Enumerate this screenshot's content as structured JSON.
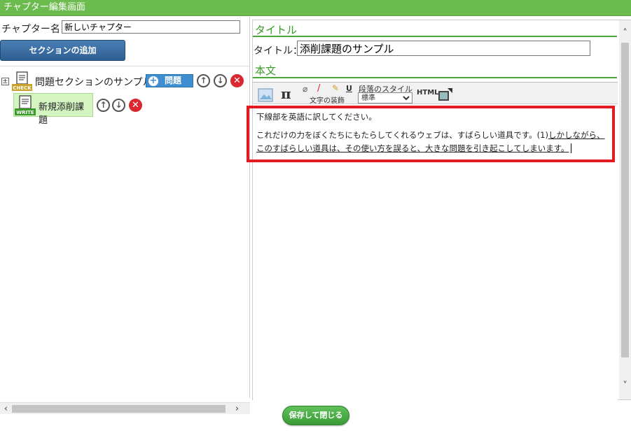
{
  "window": {
    "title": "チャプター編集画面"
  },
  "chapter": {
    "name_label": "チャプター名：",
    "name_value": "新しいチャプター"
  },
  "buttons": {
    "add_section": "セクションの追加",
    "save_close": "保存して閉じる"
  },
  "tree": {
    "expander": "±",
    "section": {
      "label": "問題セクションのサンプル",
      "add_button_label": "問題",
      "icon_text": "CHECK"
    },
    "item": {
      "label": "新規添削課題",
      "icon_text": "WRITE"
    }
  },
  "right": {
    "title_section_heading": "タイトル",
    "title_label": "タイトル：",
    "title_value": "添削課題のサンプル",
    "body_section_heading": "本文",
    "toolbar": {
      "pi": "π",
      "u": "U",
      "paragraph_style_label": "段落のスタイル",
      "paragraph_style_value": "標準",
      "text_decoration_label": "文字の装飾",
      "html": "HTML"
    },
    "editor": {
      "line1": "下線部を英語に訳してください。",
      "line2_plain": "これだけの力をぼくたちにもたらしてくれるウェブは、すばらしい道具です。(1)",
      "line2_underlined": "しかしながら、このすばらしい道具は、その使い方を誤ると、大きな問題を引き起こしてしまいます。"
    }
  },
  "colors": {
    "titlebar": "#6cbb4e",
    "accent_green": "#3a9a2a",
    "highlight_red": "#e21b23",
    "add_button_blue": "#2f5f93"
  }
}
